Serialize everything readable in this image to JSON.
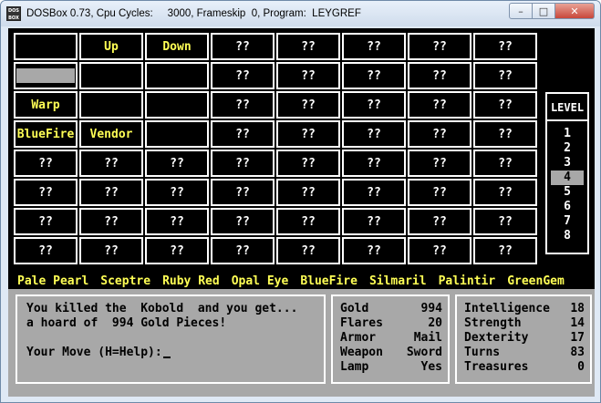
{
  "window": {
    "title": "DOSBox 0.73, Cpu Cycles:     3000, Frameskip  0, Program:  LEYGREF",
    "icon_text": "DOS BOX",
    "min_icon": "minimize-icon",
    "max_icon": "maximize-icon",
    "close_icon": "close-icon"
  },
  "map": {
    "rows": [
      [
        "",
        "Up",
        "Down",
        "??",
        "??",
        "??",
        "??",
        "??"
      ],
      [
        "#cursor",
        "",
        "",
        "??",
        "??",
        "??",
        "??",
        "??"
      ],
      [
        "Warp",
        "",
        "",
        "??",
        "??",
        "??",
        "??",
        "??"
      ],
      [
        "BlueFire",
        "Vendor",
        "",
        "??",
        "??",
        "??",
        "??",
        "??"
      ],
      [
        "??",
        "??",
        "??",
        "??",
        "??",
        "??",
        "??",
        "??"
      ],
      [
        "??",
        "??",
        "??",
        "??",
        "??",
        "??",
        "??",
        "??"
      ],
      [
        "??",
        "??",
        "??",
        "??",
        "??",
        "??",
        "??",
        "??"
      ],
      [
        "??",
        "??",
        "??",
        "??",
        "??",
        "??",
        "??",
        "??"
      ]
    ]
  },
  "level": {
    "title": "LEVEL",
    "items": [
      "1",
      "2",
      "3",
      "4",
      "5",
      "6",
      "7",
      "8"
    ],
    "current": "4"
  },
  "treasures": [
    "Pale Pearl",
    "Sceptre",
    "Ruby Red",
    "Opal Eye",
    "BlueFire",
    "Silmaril",
    "Palintir",
    "GreenGem"
  ],
  "messages": {
    "line1": "You killed the  Kobold  and you get...",
    "line2": "a hoard of  994 Gold Pieces!",
    "line3": "",
    "prompt": "Your Move (H=Help):"
  },
  "stats": [
    {
      "label": "Gold",
      "value": "994"
    },
    {
      "label": "Flares",
      "value": "20"
    },
    {
      "label": "Armor",
      "value": "Mail"
    },
    {
      "label": "Weapon",
      "value": "Sword"
    },
    {
      "label": "Lamp",
      "value": "Yes"
    }
  ],
  "attributes": [
    {
      "label": "Intelligence",
      "value": "18"
    },
    {
      "label": "Strength",
      "value": "14"
    },
    {
      "label": "Dexterity",
      "value": "17"
    },
    {
      "label": "Turns",
      "value": "83"
    },
    {
      "label": "Treasures",
      "value": "0"
    }
  ],
  "colors": {
    "screen_bg": "#000000",
    "grid_text": "#ffffff",
    "highlight_text": "#ffff55",
    "panel_bg": "#a8a8a8"
  }
}
